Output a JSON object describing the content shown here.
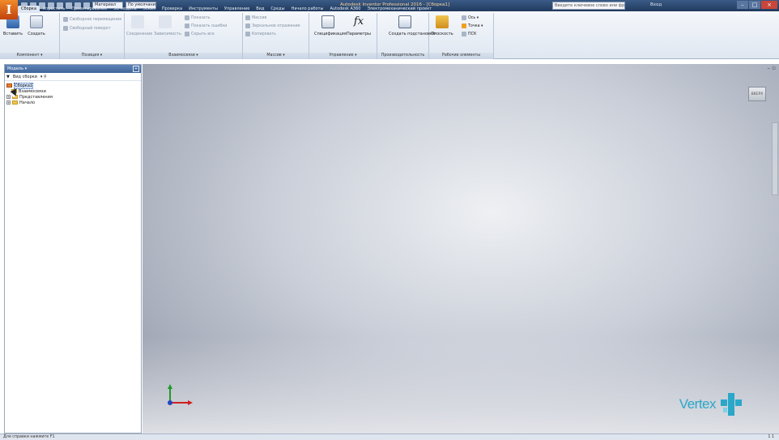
{
  "titlebar": {
    "app_letter": "I",
    "title": "Autodesk Inventor Professional 2016 - [Сборка1]",
    "material_combo": "Материал",
    "appearance_combo": "По умолчанию",
    "help_search_placeholder": "Введите ключевое слово или фразу",
    "sign_in": "Вход"
  },
  "tabs": [
    "Сборка",
    "Упростить",
    "Проектирование",
    "3D-модель",
    "Эскиз",
    "Проверка",
    "Инструменты",
    "Управление",
    "Вид",
    "Среды",
    "Начало работы",
    "Autodesk A360",
    "Электромеханический проект"
  ],
  "ribbon": {
    "component": {
      "title": "Компонент ▾",
      "insert": "Вставить",
      "create": "Создать"
    },
    "position": {
      "title": "Позиция ▾",
      "free_move": "Свободное перемещение",
      "free_rotate": "Свободный поворот"
    },
    "relations": {
      "title": "Взаимосвязи ▾",
      "joint": "Соединение",
      "constrain": "Зависимость",
      "show": "Показать",
      "show_sick": "Показать ошибки",
      "hide_all": "Скрыть все"
    },
    "pattern": {
      "title": "Массив ▾",
      "pattern": "Массив",
      "mirror": "Зеркальное отражение",
      "copy": "Копировать"
    },
    "manage": {
      "title": "Управление ▾",
      "bom": "Спецификация",
      "parameters": "Параметры"
    },
    "productivity": {
      "title": "Производительность",
      "create_substitutes": "Создать подстановки"
    },
    "work_features": {
      "title": "Рабочие элементы",
      "plane": "Плоскость",
      "axis": "Ось ▾",
      "point": "Точка ▾",
      "ucs": "ПСК"
    }
  },
  "browser": {
    "title": "Модель ▾",
    "view_label": "Вид сборки",
    "tree": [
      {
        "label": "Сборка1",
        "selected": true
      },
      {
        "label": "Взаимосвязи",
        "selected": false
      },
      {
        "label": "Представления",
        "selected": false
      },
      {
        "label": "Начало",
        "selected": false
      }
    ]
  },
  "viewport": {
    "viewcube_label": "ВВЕРХ",
    "brand": "Vertex"
  },
  "statusbar": {
    "text": "Для справки нажмите F1",
    "right": "1    1"
  },
  "colors": {
    "accent": "#2aa7c9",
    "titlebar": "#2b4a72"
  }
}
